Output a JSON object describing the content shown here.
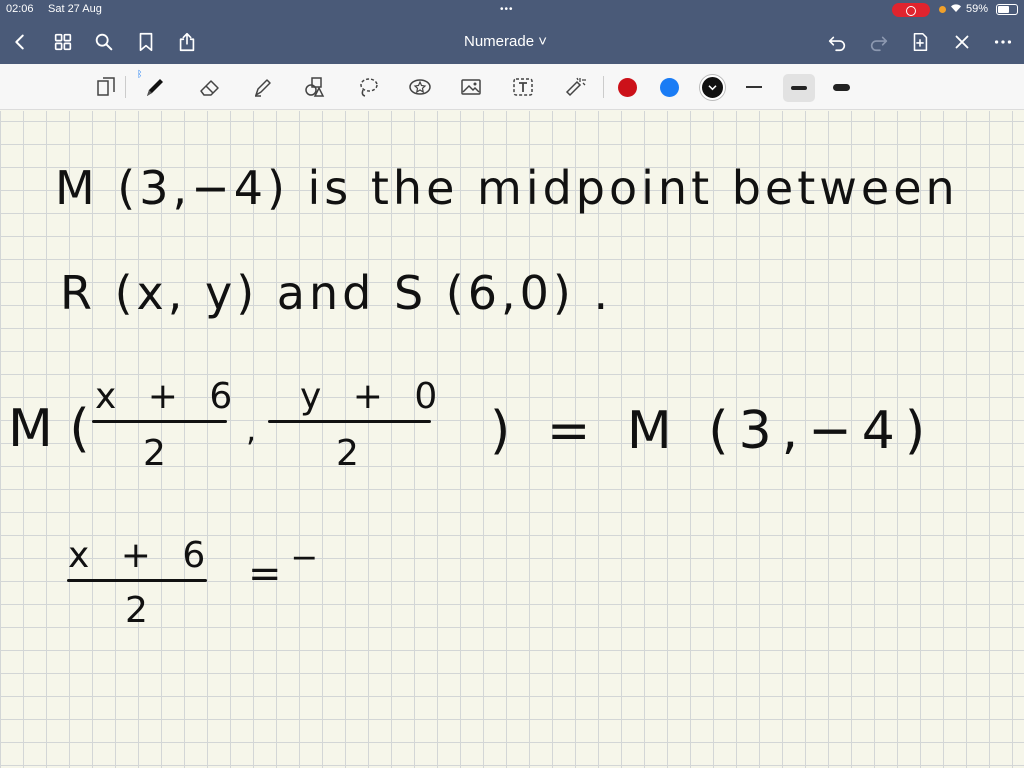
{
  "status": {
    "time": "02:06",
    "date": "Sat 27 Aug",
    "battery": "59%"
  },
  "nav": {
    "title": "Numerade ˅"
  },
  "toolbar": {
    "colors": [
      "#cc1119",
      "#1a7cf5",
      "#111111"
    ]
  },
  "notes": {
    "line1": "M (3,−4)  is  the  midpoint  between",
    "line2": "R (x, y)  and  S (6,0) .",
    "m_left": "M (",
    "num1": "x + 6",
    "den1": "2",
    "comma": ",",
    "num2": "y + 0",
    "den2": "2",
    "rhs": ") = M (3,−4)",
    "num3": "x + 6",
    "den3": "2",
    "eq3": "= ‾"
  }
}
